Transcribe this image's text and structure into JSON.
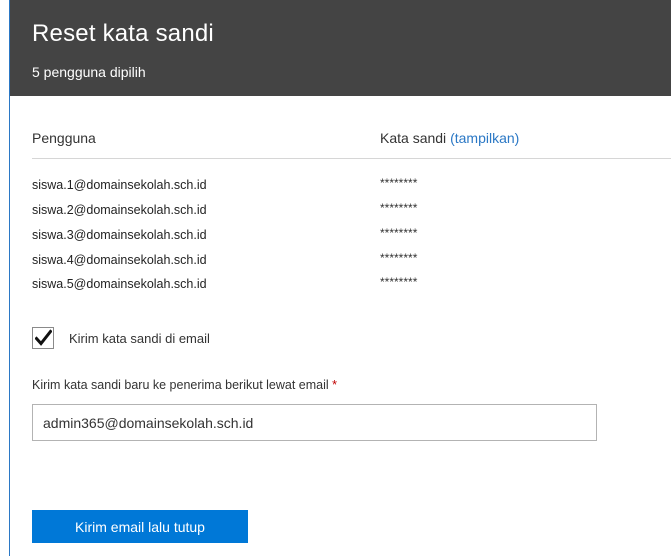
{
  "header": {
    "title": "Reset kata sandi",
    "subtitle": "5 pengguna dipilih"
  },
  "table": {
    "columns": {
      "users": "Pengguna",
      "password": "Kata sandi",
      "show_link": "(tampilkan)"
    },
    "rows": [
      {
        "user": "siswa.1@domainsekolah.sch.id",
        "password": "********"
      },
      {
        "user": "siswa.2@domainsekolah.sch.id",
        "password": "********"
      },
      {
        "user": "siswa.3@domainsekolah.sch.id",
        "password": "********"
      },
      {
        "user": "siswa.4@domainsekolah.sch.id",
        "password": "********"
      },
      {
        "user": "siswa.5@domainsekolah.sch.id",
        "password": "********"
      }
    ]
  },
  "email_option": {
    "checkbox_label": "Kirim kata sandi di email",
    "checked": true
  },
  "recipient": {
    "label": "Kirim kata sandi baru ke penerima berikut lewat email",
    "required_mark": "*",
    "value": "admin365@domainsekolah.sch.id"
  },
  "actions": {
    "submit_label": "Kirim email lalu tutup"
  },
  "colors": {
    "header_bg": "#444444",
    "accent": "#0078d7",
    "link": "#2b78c5",
    "required": "#c00000"
  }
}
